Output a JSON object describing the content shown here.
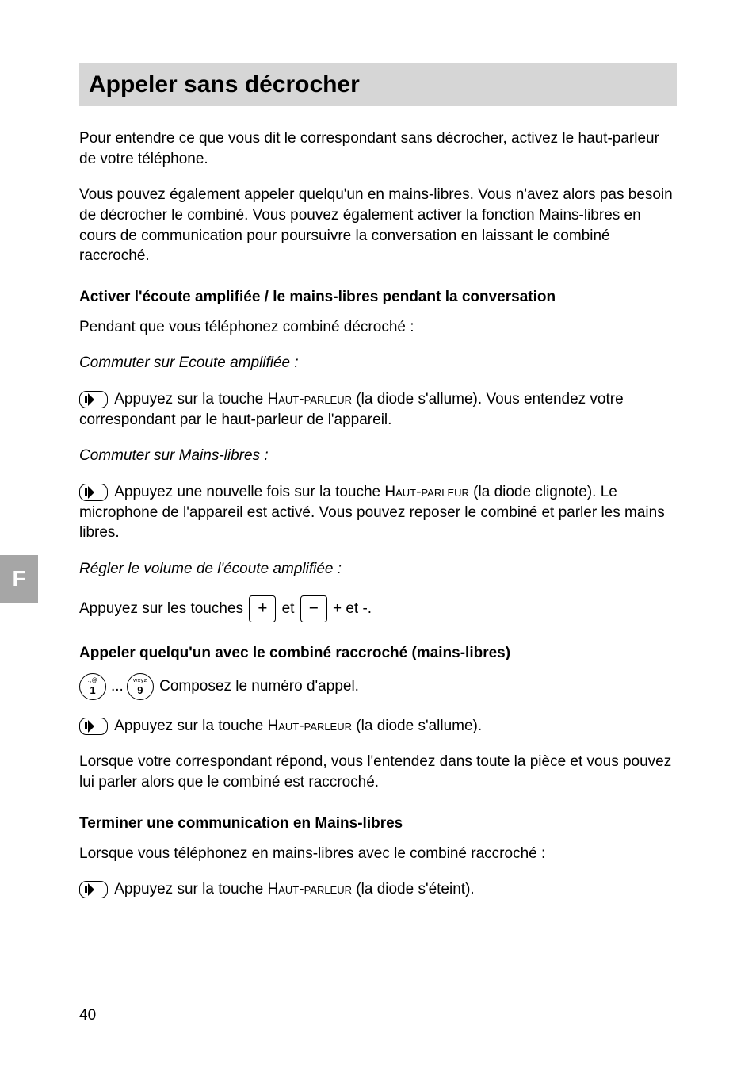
{
  "sideTab": "F",
  "title": "Appeler sans décrocher",
  "intro1": "Pour entendre ce que vous dit le correspondant sans décrocher, activez le haut-parleur de votre téléphone.",
  "intro2": "Vous pouvez également appeler quelqu'un en mains-libres. Vous n'avez alors pas besoin de décrocher le combiné. Vous pouvez également activer la fonction Mains-libres en cours de communication pour poursuivre la conversation en laissant le combiné raccroché.",
  "section1": {
    "heading": "Activer l'écoute amplifiée / le mains-libres pendant la conversation",
    "line1": "Pendant que vous téléphonez combiné décroché :",
    "sub1": "Commuter sur Ecoute amplifiée :",
    "step1_pre": " Appuyez sur la touche ",
    "step1_caps": "Haut-parleur",
    "step1_post": " (la diode s'allume). Vous entendez votre correspondant par le haut-parleur de l'appareil.",
    "sub2": "Commuter sur Mains-libres :",
    "step2_pre": " Appuyez une nouvelle fois sur la touche ",
    "step2_caps": "Haut-parleur",
    "step2_post": " (la diode clignote). Le microphone de l'appareil est activé. Vous pouvez reposer le combiné et parler les mains libres.",
    "sub3": "Régler le volume de l'écoute amplifiée :",
    "step3_pre": "Appuyez sur les touches ",
    "step3_mid": " et ",
    "step3_post": " + et -.",
    "plus": "+",
    "minus": "−"
  },
  "section2": {
    "heading": "Appeler quelqu'un avec le combiné raccroché (mains-libres)",
    "key1_letters": ".,@",
    "key1_digit": "1",
    "dots": "...",
    "key9_letters": "wxyz",
    "key9_digit": "9",
    "step1": " Composez le numéro d'appel.",
    "step2_pre": " Appuyez sur la touche ",
    "step2_caps": "Haut-parleur",
    "step2_post": " (la diode s'allume).",
    "line3": "Lorsque votre correspondant répond, vous l'entendez dans toute la pièce et vous pouvez lui parler alors que le combiné est raccroché."
  },
  "section3": {
    "heading": "Terminer une communication en Mains-libres",
    "line1": "Lorsque vous téléphonez en mains-libres avec le combiné raccroché :",
    "step1_pre": " Appuyez sur la touche ",
    "step1_caps": "Haut-parleur",
    "step1_post": " (la diode s'éteint)."
  },
  "pageNumber": "40"
}
